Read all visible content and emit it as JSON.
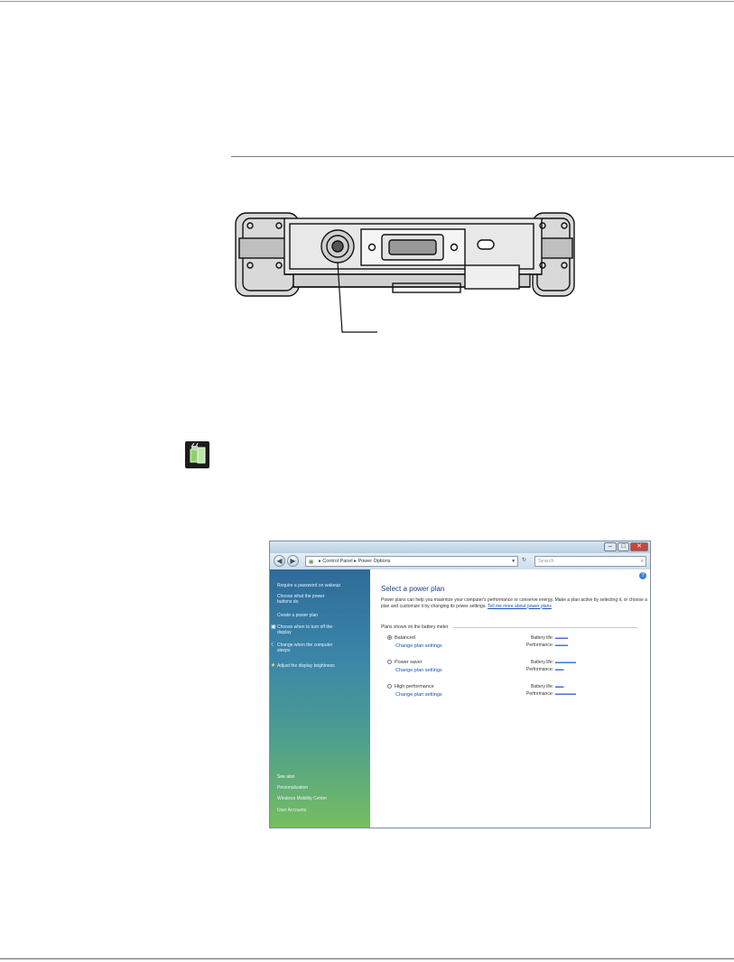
{
  "window": {
    "breadcrumb": [
      "Control Panel",
      "Power Options"
    ],
    "search_placeholder": "Search",
    "caption_buttons": [
      "–",
      "□",
      "✕"
    ]
  },
  "sidebar": {
    "items": [
      {
        "label": "Require a password on wakeup",
        "icon": ""
      },
      {
        "label": "Choose what the power buttons do",
        "icon": ""
      },
      {
        "label": "Create a power plan",
        "icon": ""
      },
      {
        "label": "Choose when to turn off the display",
        "icon": "monitor-icon"
      },
      {
        "label": "Change when the computer sleeps",
        "icon": "moon-icon"
      },
      {
        "label": "Adjust the display brightness",
        "icon": "brightness-icon"
      }
    ],
    "see_also_heading": "See also",
    "see_also_items": [
      "Personalization",
      "Windows Mobility Center",
      "User Accounts"
    ]
  },
  "main": {
    "heading": "Select a power plan",
    "description": "Power plans can help you maximize your computer's performance or conserve energy. Make a plan active by selecting it, or choose a plan and customize it by changing its power settings.",
    "description_link": "Tell me more about power plans",
    "group_label": "Plans shown on the battery meter",
    "plans": [
      {
        "name": "Balanced",
        "selected": true,
        "change_link": "Change plan settings",
        "battery_label": "Battery life:",
        "battery_level": 3,
        "performance_label": "Performance:",
        "performance_level": 3
      },
      {
        "name": "Power saver",
        "selected": false,
        "change_link": "Change plan settings",
        "battery_label": "Battery life:",
        "battery_level": 5,
        "performance_label": "Performance:",
        "performance_level": 2
      },
      {
        "name": "High performance",
        "selected": false,
        "change_link": "Change plan settings",
        "battery_label": "Battery life:",
        "battery_level": 2,
        "performance_label": "Performance:",
        "performance_level": 5
      }
    ]
  },
  "colors": {
    "accent_link": "#1551b5",
    "heading": "#1e3f8a",
    "rating_bars": "#4a6fd8",
    "sidebar_top": "#2e6c9a",
    "sidebar_bottom": "#78bf5f"
  }
}
